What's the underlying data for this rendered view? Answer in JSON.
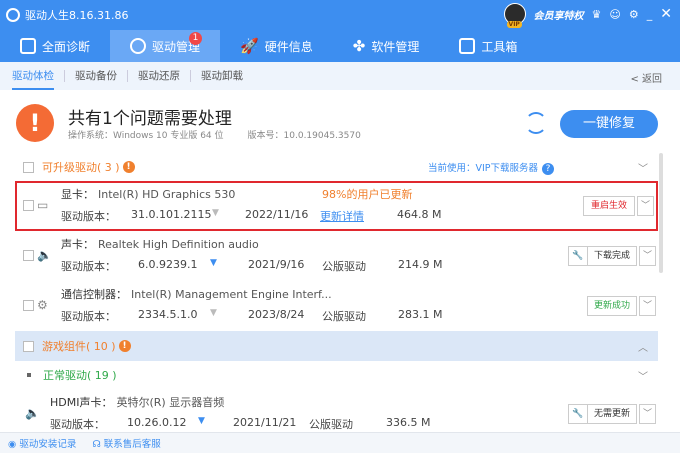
{
  "app": {
    "title": "驱动人生8.16.31.86",
    "member": "会员享特权",
    "vip": "VIP"
  },
  "tabs": [
    {
      "label": "全面诊断"
    },
    {
      "label": "驱动管理",
      "badge": "1"
    },
    {
      "label": "硬件信息"
    },
    {
      "label": "软件管理"
    },
    {
      "label": "工具箱"
    }
  ],
  "subnav": [
    "驱动体检",
    "驱动备份",
    "驱动还原",
    "驱动卸载"
  ],
  "back": "< 返回",
  "summary": {
    "title": "共有1个问题需要处理",
    "os": "操作系统：Windows 10 专业版 64 位",
    "version": "版本号：10.0.19045.3570",
    "fix": "一键修复"
  },
  "sections": {
    "upgradable": "可升级驱动( 3 )",
    "server": "当前使用：VIP下载服务器",
    "games": "游戏组件( 10 )",
    "normal": "正常驱动( 19 )"
  },
  "drivers": [
    {
      "type": "显卡：",
      "name": "Intel(R) HD Graphics 530",
      "ver_label": "驱动版本：",
      "ver": "31.0.101.2115",
      "date": "2022/11/16",
      "note": "98%的用户已更新",
      "extra": "更新详情",
      "size": "464.8 M",
      "action": "重启生效"
    },
    {
      "type": "声卡：",
      "name": "Realtek High Definition audio",
      "ver_label": "驱动版本：",
      "ver": "6.0.9239.1",
      "date": "2021/9/16",
      "extra": "公版驱动",
      "size": "214.9 M",
      "action": "下载完成"
    },
    {
      "type": "通信控制器：",
      "name": "Intel(R) Management Engine Interf...",
      "ver_label": "驱动版本：",
      "ver": "2334.5.1.0",
      "date": "2023/8/24",
      "extra": "公版驱动",
      "size": "283.1 M",
      "action": "更新成功"
    },
    {
      "type": "HDMI声卡：",
      "name": "英特尔(R) 显示器音频",
      "ver_label": "驱动版本：",
      "ver": "10.26.0.12",
      "date": "2021/11/21",
      "extra": "公版驱动",
      "size": "336.5 M",
      "action": "无需更新"
    }
  ],
  "bottom": {
    "record": "驱动安装记录",
    "support": "联系售后客服"
  }
}
